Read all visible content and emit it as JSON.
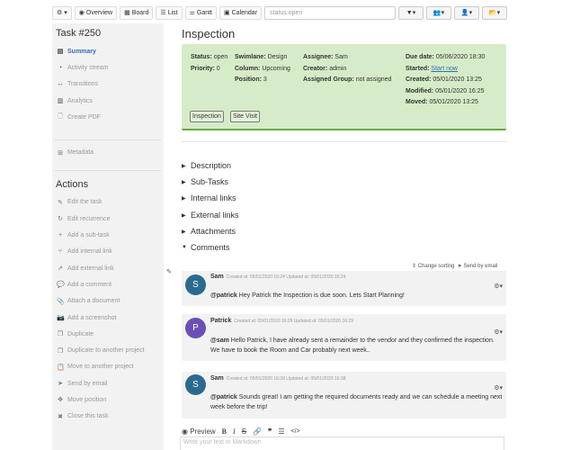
{
  "toolbar": {
    "settings_caret": "▾",
    "overview": "Overview",
    "board": "Board",
    "list": "List",
    "gantt": "Gantt",
    "calendar": "Calendar",
    "search_value": "status:open",
    "filter_caret": "▾",
    "users_caret": "▾",
    "user_caret": "▾",
    "folder_caret": "▾"
  },
  "sidebar": {
    "title": "Task #250",
    "nav": [
      {
        "icon": "list-icon",
        "label": "Summary"
      },
      {
        "icon": "dashboard-icon",
        "label": "Activity stream"
      },
      {
        "icon": "arrows-icon",
        "label": "Transitions"
      },
      {
        "icon": "chart-icon",
        "label": "Analytics"
      },
      {
        "icon": "pdf-icon",
        "label": "Create PDF"
      }
    ],
    "metadata": "Metadata",
    "actions_title": "Actions",
    "actions": [
      {
        "icon": "edit-icon",
        "label": "Edit the task"
      },
      {
        "icon": "refresh-icon",
        "label": "Edit recurrence"
      },
      {
        "icon": "plus-icon",
        "label": "Add a sub-task"
      },
      {
        "icon": "code-fork-icon",
        "label": "Add internal link"
      },
      {
        "icon": "external-link-icon",
        "label": "Add external link"
      },
      {
        "icon": "comment-icon",
        "label": "Add a comment"
      },
      {
        "icon": "paperclip-icon",
        "label": "Attach a document"
      },
      {
        "icon": "camera-icon",
        "label": "Add a screenshot"
      },
      {
        "icon": "copy-icon",
        "label": "Duplicate"
      },
      {
        "icon": "copy-icon",
        "label": "Duplicate to another project"
      },
      {
        "icon": "clipboard-icon",
        "label": "Move to another project"
      },
      {
        "icon": "send-icon",
        "label": "Send by email"
      },
      {
        "icon": "move-icon",
        "label": "Move position"
      },
      {
        "icon": "close-icon",
        "label": "Close this task"
      }
    ]
  },
  "main": {
    "title": "Inspection",
    "info": {
      "status_label": "Status:",
      "status": "open",
      "priority_label": "Priority:",
      "priority": "0",
      "swimlane_label": "Swimlane:",
      "swimlane": "Design",
      "column_label": "Column:",
      "column": "Upcoming",
      "position_label": "Position:",
      "position": "3",
      "assignee_label": "Assignee:",
      "assignee": "Sam",
      "creator_label": "Creator:",
      "creator": "admin",
      "group_label": "Assigned Group:",
      "group": "not assigned",
      "due_label": "Due date:",
      "due": "05/06/2020 18:30",
      "started_label": "Started:",
      "started": "Start now",
      "created_label": "Created:",
      "created": "05/01/2020 13:25",
      "modified_label": "Modified:",
      "modified": "05/01/2020 16:25",
      "moved_label": "Moved:",
      "moved": "05/01/2020 13:25",
      "tags": [
        "Inspection",
        "Site Visit"
      ]
    },
    "sections": [
      {
        "label": "Description",
        "state": "▶"
      },
      {
        "label": "Sub-Tasks",
        "state": "▶"
      },
      {
        "label": "Internal links",
        "state": "▶"
      },
      {
        "label": "External links",
        "state": "▶"
      },
      {
        "label": "Attachments",
        "state": "▶"
      },
      {
        "label": "Comments",
        "state": "▼"
      }
    ],
    "change_sorting": "Change sorting",
    "send_by_email": "Send by email",
    "comments": [
      {
        "initial": "S",
        "author": "Sam",
        "meta": "Created at: 05/01/2020 16:24 Updated at: 05/01/2020 16:24",
        "mention": "@patrick",
        "text": "Hey Patrick the Inspection is due soon. Lets Start Planning!",
        "color": "#2a6a8f"
      },
      {
        "initial": "P",
        "author": "Patrick",
        "meta": "Created at: 05/01/2020 16:29 Updated at: 05/01/2020 16:29",
        "mention": "@sam",
        "text": "Hello Patrick, I have already sent a remainder to the vendor and they confirmed the inspection. We have to book the Room and Car probably next week..",
        "color": "#6a4fb5"
      },
      {
        "initial": "S",
        "author": "Sam",
        "meta": "Created at: 05/01/2020 16:38 Updated at: 05/01/2020 16:38",
        "mention": "@patrick",
        "text": "Sounds great! I am getting the required documents ready and we can schedule a meeting next week before the trip!",
        "color": "#2a6a8f"
      }
    ],
    "editor": {
      "preview": "Preview",
      "placeholder": "Write your text in Markdown"
    }
  }
}
